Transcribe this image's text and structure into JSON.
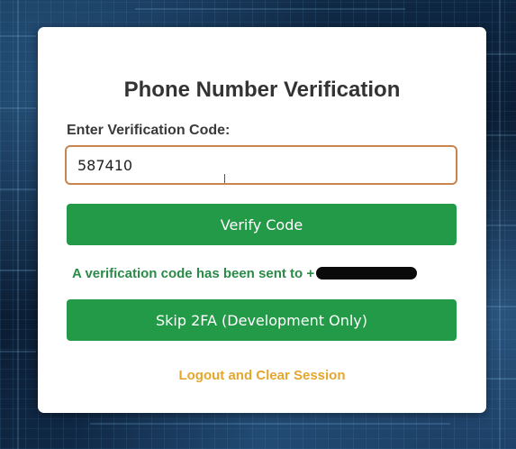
{
  "page": {
    "title": "Phone Number Verification"
  },
  "form": {
    "code_label": "Enter Verification Code:",
    "code_value": "587410",
    "verify_label": "Verify Code",
    "sent_message": "A verification code has been sent to +",
    "skip_label": "Skip 2FA (Development Only)",
    "logout_label": "Logout and Clear Session"
  },
  "colors": {
    "primary_button": "#239a47",
    "success_text": "#2a8a47",
    "link_text": "#e3a72f",
    "input_border": "#c9854f"
  }
}
